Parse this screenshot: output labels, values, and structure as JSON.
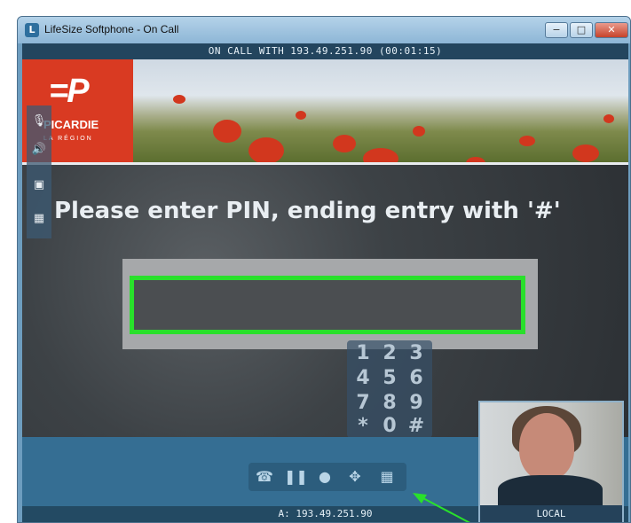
{
  "window": {
    "title": "LifeSize Softphone - On Call",
    "controls": {
      "minimize": "−",
      "maximize": "□",
      "close": "✕"
    }
  },
  "call": {
    "status": "ON CALL WITH 193.49.251.90 (00:01:15)",
    "remote_address": "A: 193.49.251.90"
  },
  "banner": {
    "logo_mark": "=P",
    "logo_name": "PICARDIE",
    "logo_sub": "LA RÉGION"
  },
  "prompt": {
    "text": "Please enter PIN, ending entry with '#'"
  },
  "pin_field": {
    "value": ""
  },
  "keypad": {
    "keys": [
      "1",
      "2",
      "3",
      "4",
      "5",
      "6",
      "7",
      "8",
      "9",
      "*",
      "0",
      "#"
    ]
  },
  "sidebar": {
    "icons": [
      "microphone-icon",
      "speaker-icon",
      "camera-icon",
      "layout-icon"
    ]
  },
  "toolbar": {
    "icons": [
      "hangup-icon",
      "pause-icon",
      "record-icon",
      "move-icon",
      "keypad-icon"
    ]
  },
  "selfview": {
    "label": "LOCAL"
  },
  "colors": {
    "accent_green": "#29e02b",
    "call_bar": "#356e93",
    "logo_red": "#d93a22"
  }
}
